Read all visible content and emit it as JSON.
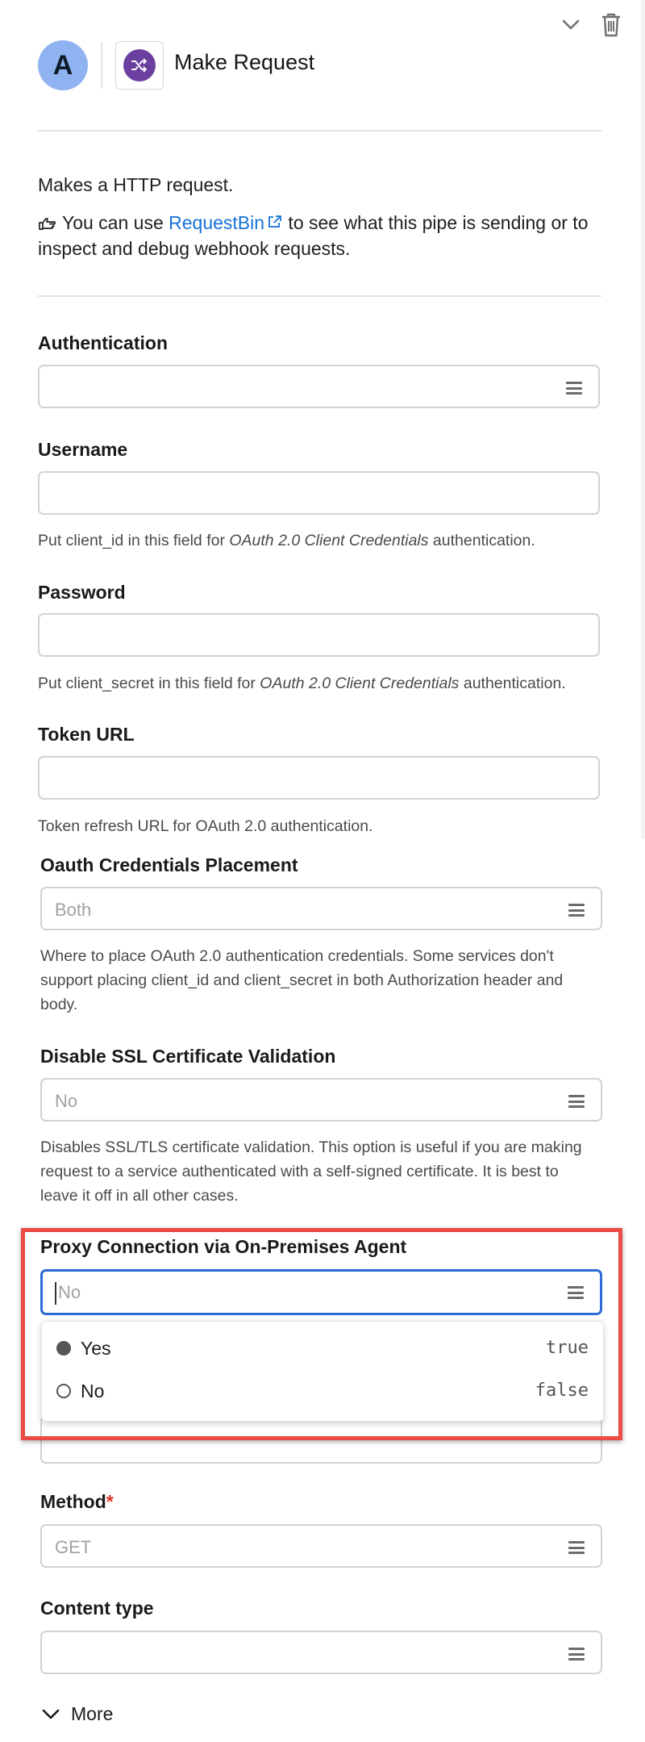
{
  "header": {
    "title": "Make Request",
    "avatar_letter": "A",
    "collapse_icon": "chevron-down-icon",
    "delete_icon": "trash-icon",
    "app_icon": "shuffle-icon"
  },
  "description": {
    "line1": "Makes a HTTP request.",
    "hint_prefix": " You can use ",
    "link_text": "RequestBin",
    "hint_suffix_1": " to see what this pipe is sending or to",
    "hint_suffix_2": "inspect and debug webhook requests."
  },
  "fields": {
    "authentication": {
      "label": "Authentication",
      "value": ""
    },
    "username": {
      "label": "Username",
      "value": "",
      "help_prefix": "Put client_id in this field for ",
      "help_em": "OAuth 2.0 Client Credentials",
      "help_suffix": " authentication."
    },
    "password": {
      "label": "Password",
      "value": "",
      "help_prefix": "Put client_secret in this field for ",
      "help_em": "OAuth 2.0 Client Credentials",
      "help_suffix": " authentication."
    },
    "token_url": {
      "label": "Token URL",
      "value": "",
      "help": "Token refresh URL for OAuth 2.0 authentication."
    },
    "oauth_placement": {
      "label": "Oauth Credentials Placement",
      "value": "Both",
      "help_1": "Where to place OAuth 2.0 authentication credentials. Some services don't",
      "help_2": "support placing client_id and client_secret in both Authorization header and",
      "help_3": "body."
    },
    "disable_ssl": {
      "label": "Disable SSL Certificate Validation",
      "value": "No",
      "help_1": "Disables SSL/TLS certificate validation. This option is useful if you are making",
      "help_2": "request to a service authenticated with a self-signed certificate. It is best to",
      "help_3": "leave it off in all other cases."
    },
    "proxy": {
      "label": "Proxy Connection via On-Premises Agent",
      "placeholder": "No",
      "options": [
        {
          "label": "Yes",
          "value": "true",
          "selected": true
        },
        {
          "label": "No",
          "value": "false",
          "selected": false
        }
      ]
    },
    "method": {
      "label": "Method",
      "required_mark": "*",
      "value": "GET"
    },
    "content_type": {
      "label": "Content type",
      "value": ""
    }
  },
  "footer": {
    "more_label": "More"
  },
  "colors": {
    "link": "#1673d6",
    "highlight": "#ea4b45",
    "focus": "#2d6bd6",
    "avatar": "#8fb3f0",
    "app_icon": "#6b3fa0"
  }
}
